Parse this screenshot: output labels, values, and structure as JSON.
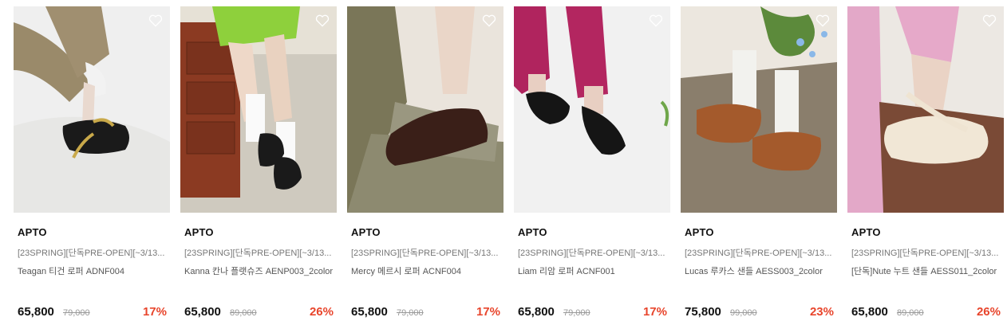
{
  "products": [
    {
      "brand": "APTO",
      "badge": "[23SPRING][단독PRE-OPEN][~3/13...",
      "name": "Teagan 티건 로퍼 ADNF004",
      "price": "65,800",
      "original_price": "79,000",
      "discount": "17%",
      "image": "white-studio-black-loafer"
    },
    {
      "brand": "APTO",
      "badge": "[23SPRING][단독PRE-OPEN][~3/13...",
      "name": "Kanna 칸나 플랫슈즈 AENP003_2color",
      "price": "65,800",
      "original_price": "89,000",
      "discount": "26%",
      "image": "green-skirt-mary-jane"
    },
    {
      "brand": "APTO",
      "badge": "[23SPRING][단독PRE-OPEN][~3/13...",
      "name": "Mercy 메르시 로퍼 ACNF004",
      "price": "65,800",
      "original_price": "79,000",
      "discount": "17%",
      "image": "brown-loafer-on-step"
    },
    {
      "brand": "APTO",
      "badge": "[23SPRING][단독PRE-OPEN][~3/13...",
      "name": "Liam 리암 로퍼 ACNF001",
      "price": "65,800",
      "original_price": "79,000",
      "discount": "17%",
      "image": "magenta-pants-loafers"
    },
    {
      "brand": "APTO",
      "badge": "[23SPRING][단독PRE-OPEN][~3/13...",
      "name": "Lucas 루카스 샌들 AESS003_2color",
      "price": "75,800",
      "original_price": "99,000",
      "discount": "23%",
      "image": "brown-fisherman-sandal"
    },
    {
      "brand": "APTO",
      "badge": "[23SPRING][단독PRE-OPEN][~3/13...",
      "name": "[단독]Nute 누트 샌들 AESS011_2color",
      "price": "65,800",
      "original_price": "89,000",
      "discount": "26%",
      "image": "cream-sport-sandal"
    }
  ],
  "colors": {
    "discount": "#e8452c",
    "brand": "#111111",
    "muted": "#777777"
  },
  "icons": {
    "wishlist": "heart-outline-icon"
  }
}
